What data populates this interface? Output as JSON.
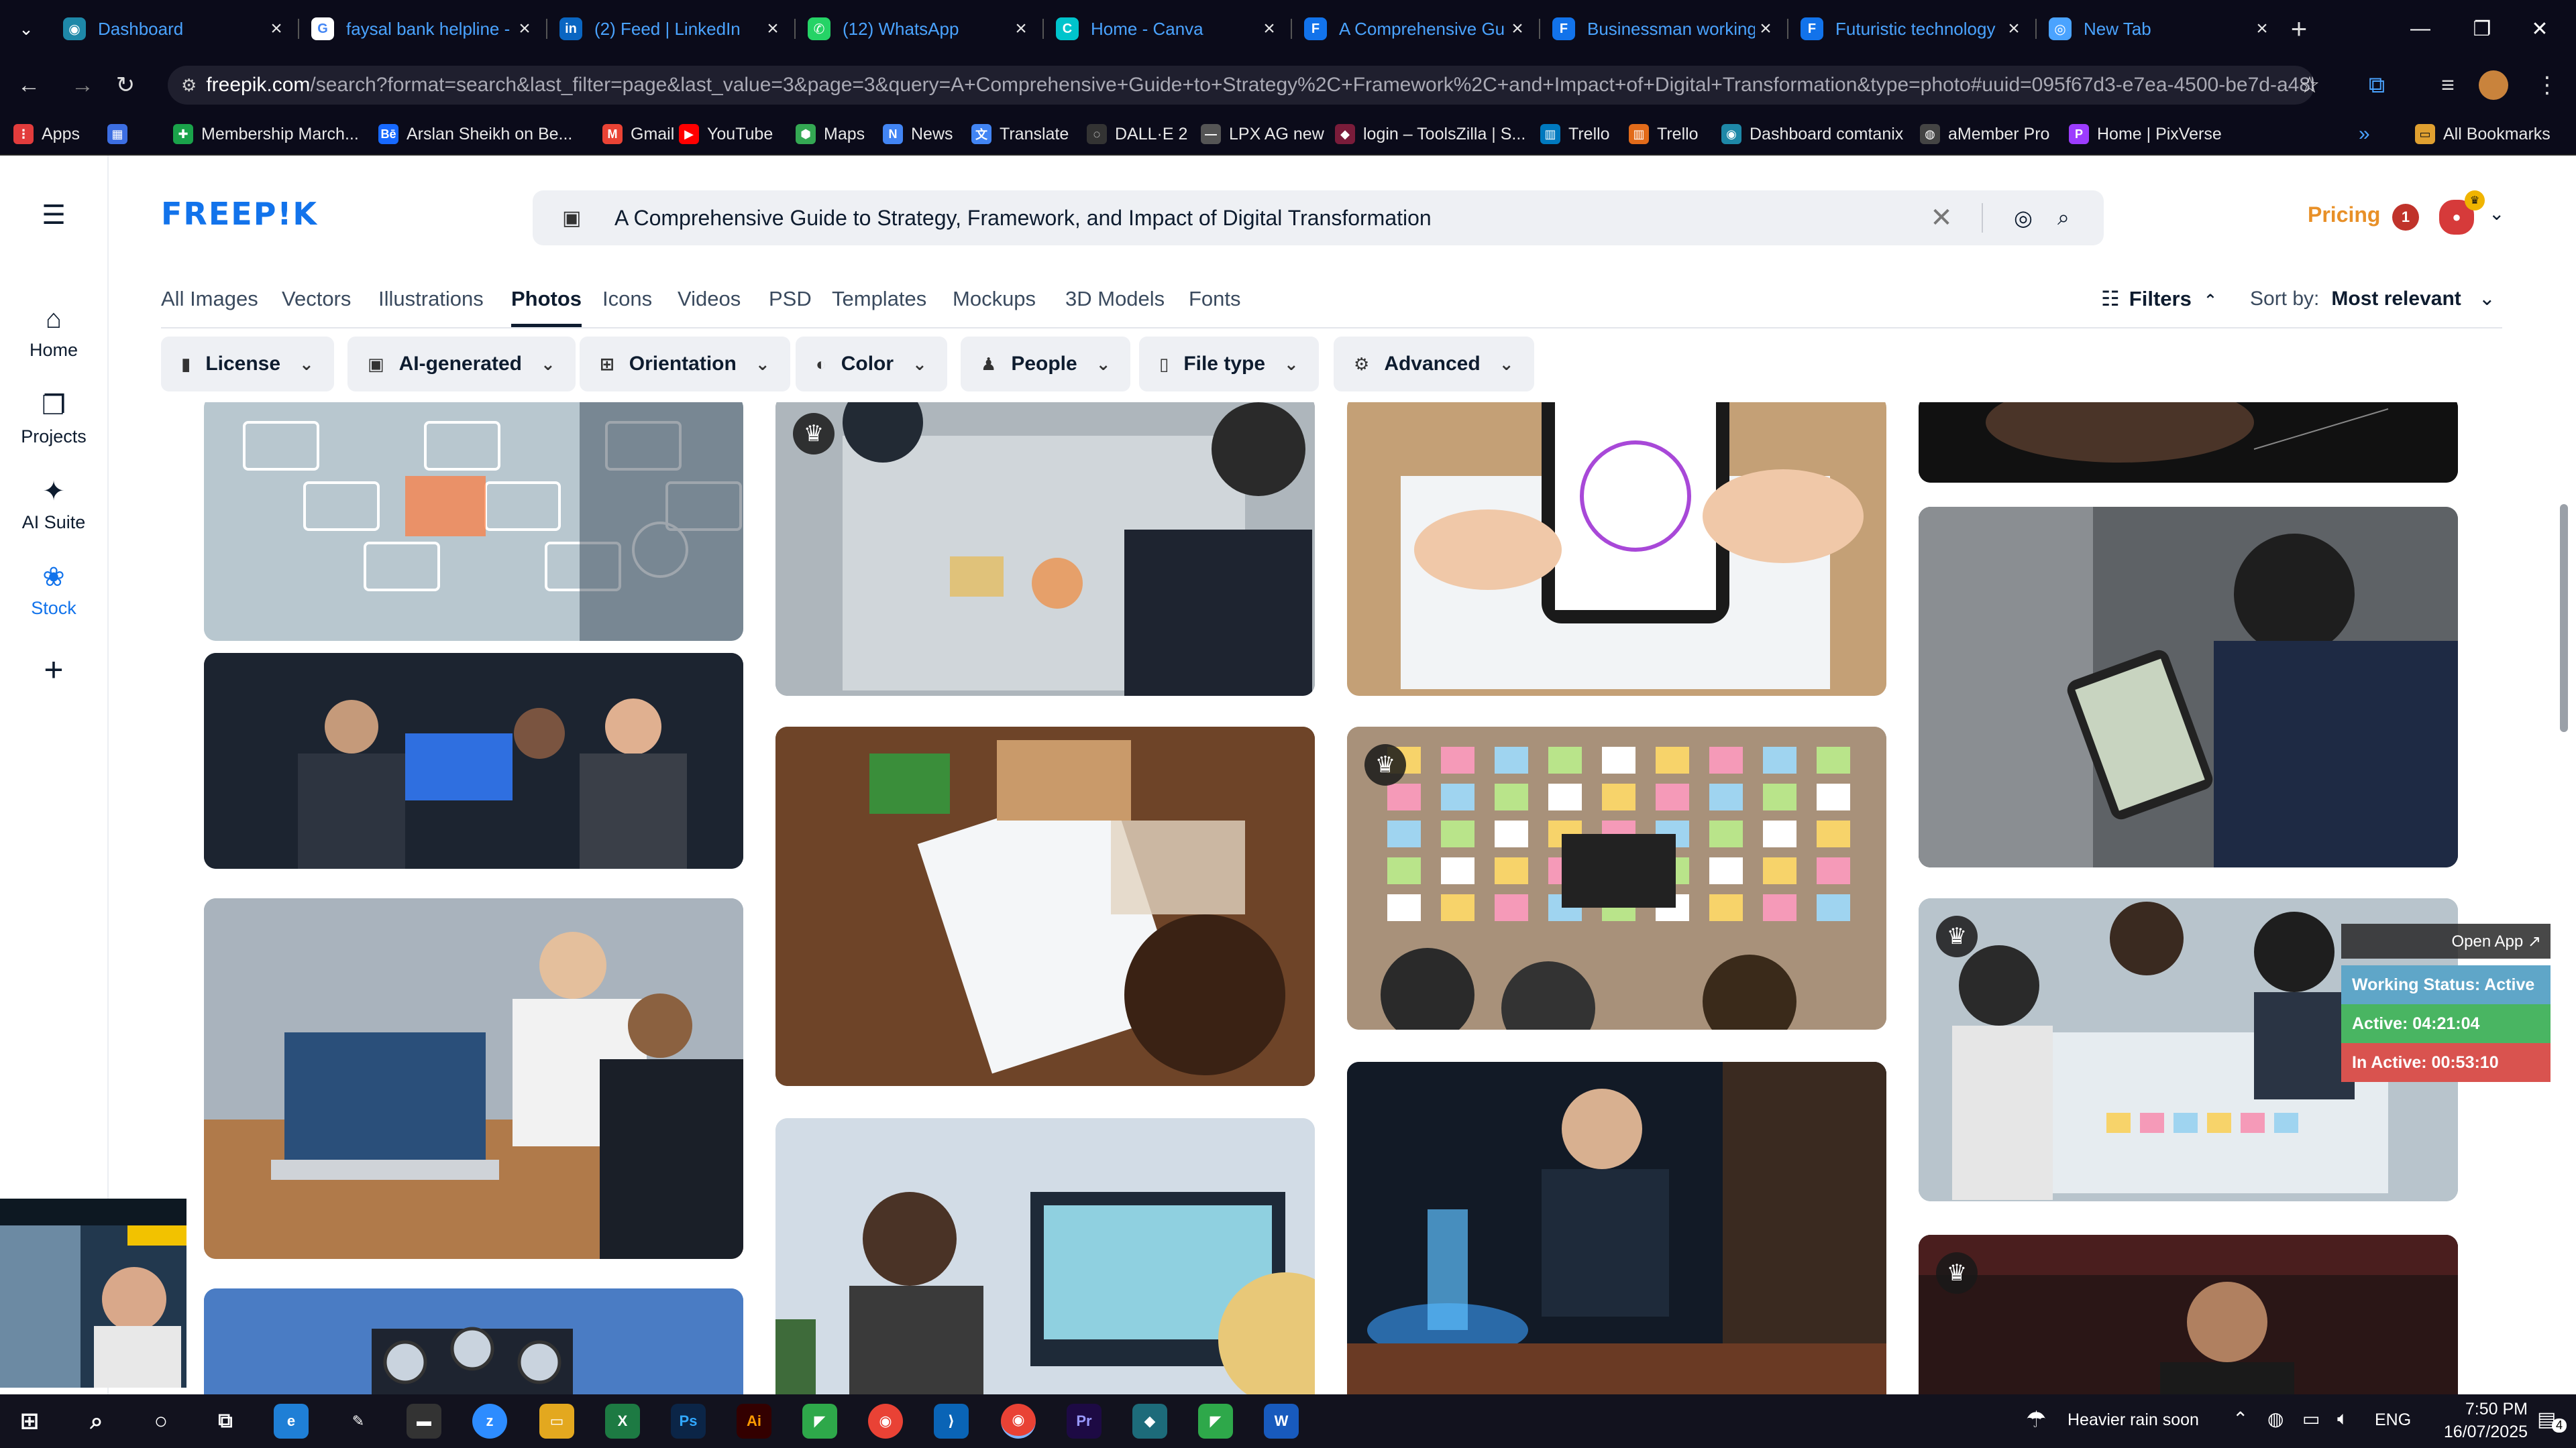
{
  "browser": {
    "tabs": [
      {
        "title": "Dashboard",
        "color": "#1e88a8",
        "glyph": "◉"
      },
      {
        "title": "faysal bank helpline -",
        "color": "#ffffff",
        "glyph": "G"
      },
      {
        "title": "(2) Feed | LinkedIn",
        "color": "#0a66c2",
        "glyph": "in"
      },
      {
        "title": "(12) WhatsApp",
        "color": "#25d366",
        "glyph": "✆"
      },
      {
        "title": "Home - Canva",
        "color": "#00c4cc",
        "glyph": "C"
      },
      {
        "title": "A Comprehensive Gu",
        "color": "#1273eb",
        "glyph": "F"
      },
      {
        "title": "Businessman working",
        "color": "#1273eb",
        "glyph": "F"
      },
      {
        "title": "Futuristic technology",
        "color": "#1273eb",
        "glyph": "F"
      },
      {
        "title": "New Tab",
        "color": "#4aa3ff",
        "glyph": "◎"
      }
    ],
    "new_tab_icon": "plus-icon",
    "url_domain": "freepik.com",
    "url_path": "/search?format=search&last_filter=page&last_value=3&page=3&query=A+Comprehensive+Guide+to+Strategy%2C+Framework%2C+and+Impact+of+Digital+Transformation&type=photo#uuid=095f67d3-e7ea-4500-be7d-a48bfbc88e...",
    "bookmarks": [
      {
        "label": "Apps",
        "color": "#e23c3c",
        "glyph": "⋮"
      },
      {
        "label": "",
        "color": "#3c6ee2",
        "glyph": "▦"
      },
      {
        "label": "Membership March...",
        "color": "#1aa34a",
        "glyph": "✚"
      },
      {
        "label": "Arslan Sheikh on Be...",
        "color": "#1769ff",
        "glyph": "Bē"
      },
      {
        "label": "Gmail",
        "color": "#ea4335",
        "glyph": "M"
      },
      {
        "label": "YouTube",
        "color": "#ff0000",
        "glyph": "▶"
      },
      {
        "label": "Maps",
        "color": "#34a853",
        "glyph": "⬢"
      },
      {
        "label": "News",
        "color": "#4285f4",
        "glyph": "N"
      },
      {
        "label": "Translate",
        "color": "#4285f4",
        "glyph": "文"
      },
      {
        "label": "DALL·E 2",
        "color": "#333333",
        "glyph": "◌"
      },
      {
        "label": "LPX AG new",
        "color": "#555555",
        "glyph": "—"
      },
      {
        "label": "login – ToolsZilla | S...",
        "color": "#7a1c3a",
        "glyph": "◆"
      },
      {
        "label": "Trello",
        "color": "#0079bf",
        "glyph": "▥"
      },
      {
        "label": "Trello",
        "color": "#e26b1a",
        "glyph": "▥"
      },
      {
        "label": "Dashboard comtanix",
        "color": "#1e88a8",
        "glyph": "◉"
      },
      {
        "label": "aMember Pro",
        "color": "#444444",
        "glyph": "◍"
      },
      {
        "label": "Home | PixVerse",
        "color": "#9c3cff",
        "glyph": "P"
      }
    ],
    "all_bookmarks": "All Bookmarks"
  },
  "sidebar": {
    "items": [
      {
        "label": "Home",
        "icon": "house-icon"
      },
      {
        "label": "Projects",
        "icon": "folders-icon"
      },
      {
        "label": "AI Suite",
        "icon": "sparkle-icon"
      },
      {
        "label": "Stock",
        "icon": "stock-icon"
      }
    ],
    "add_icon": "plus-icon",
    "menu_icon": "hamburger-icon"
  },
  "header": {
    "logo": "FREEP!K",
    "search_query": "A Comprehensive Guide to Strategy, Framework, and Impact of Digital Transformation",
    "pricing": "Pricing",
    "notification_count": "1"
  },
  "type_tabs": [
    "All Images",
    "Vectors",
    "Illustrations",
    "Photos",
    "Icons",
    "Videos",
    "PSD",
    "Templates",
    "Mockups",
    "3D Models",
    "Fonts"
  ],
  "active_tab": "Photos",
  "filters_label": "Filters",
  "sort": {
    "label": "Sort by:",
    "value": "Most relevant"
  },
  "filter_chips": [
    {
      "label": "License",
      "icon": "license-icon"
    },
    {
      "label": "AI-generated",
      "icon": "ai-image-icon"
    },
    {
      "label": "Orientation",
      "icon": "orientation-icon"
    },
    {
      "label": "Color",
      "icon": "palette-icon"
    },
    {
      "label": "People",
      "icon": "people-icon"
    },
    {
      "label": "File type",
      "icon": "file-icon"
    },
    {
      "label": "Advanced",
      "icon": "settings-icon"
    }
  ],
  "tracker": {
    "open_app": "Open App ↗",
    "status": "Working Status: Active",
    "active": "Active: 04:21:04",
    "inactive": "In Active: 00:53:10"
  },
  "taskbar": {
    "weather": "Heavier rain soon",
    "lang": "ENG",
    "time": "7:50 PM",
    "date": "16/07/2025",
    "notif_count": "4"
  }
}
